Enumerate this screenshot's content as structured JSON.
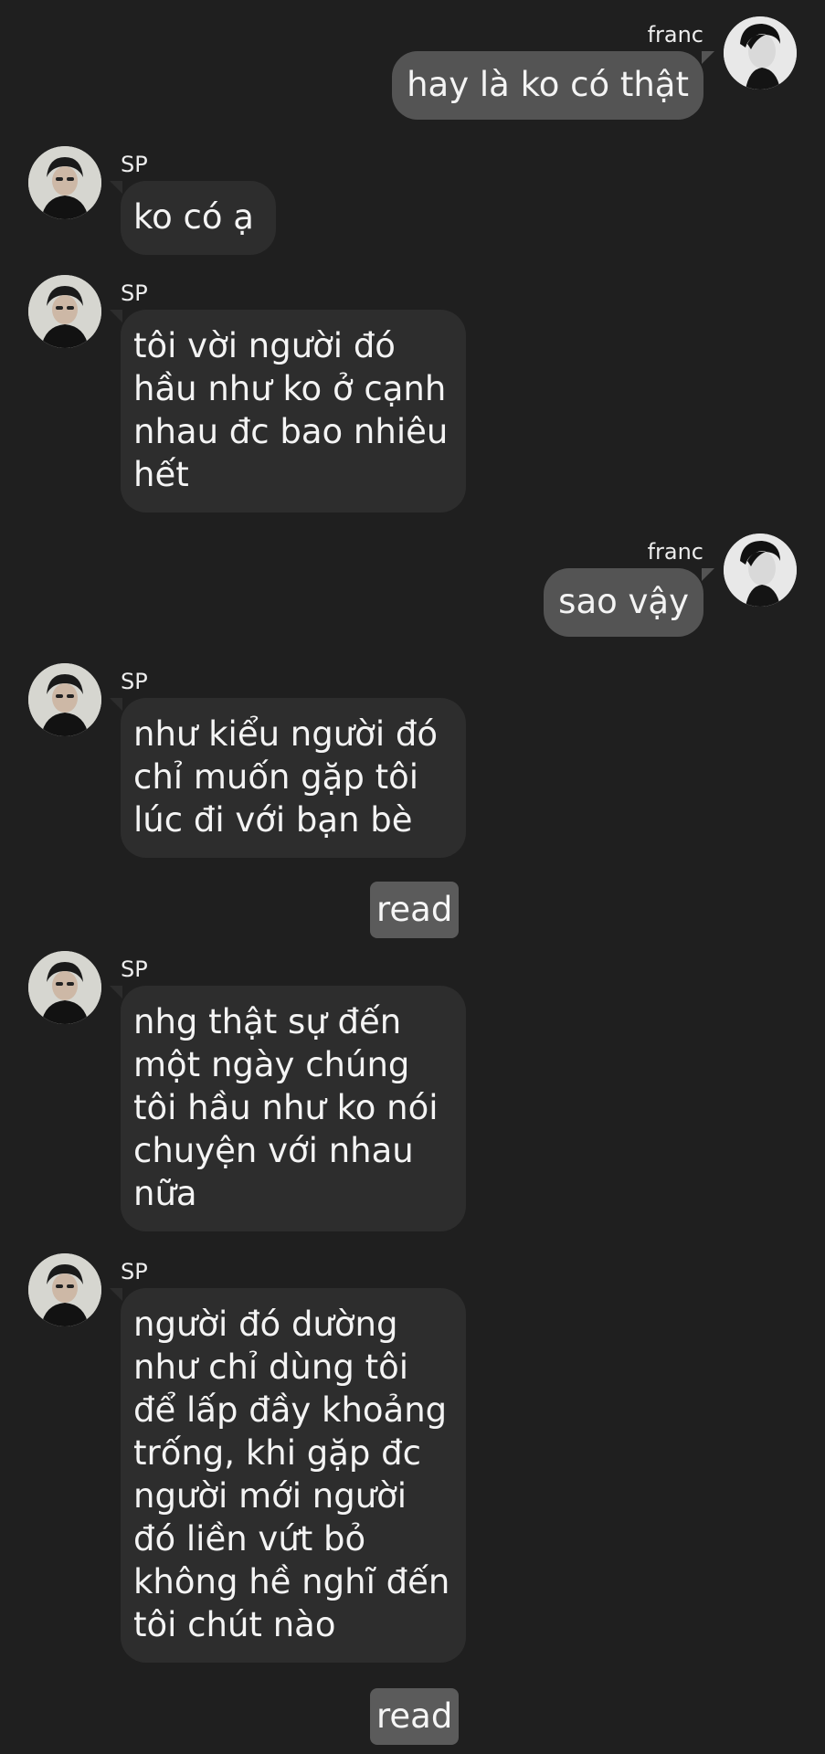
{
  "contacts": {
    "me": {
      "name": "franc",
      "avatar_icon": "profile-photo-icon"
    },
    "other": {
      "name": "SP",
      "avatar_icon": "profile-photo-icon"
    }
  },
  "messages": [
    {
      "from": "franc",
      "lines": [
        "hay là ko có thật"
      ]
    },
    {
      "from": "SP",
      "lines": [
        "ko có ạ"
      ]
    },
    {
      "from": "SP",
      "lines": [
        "tôi vời người đó",
        "hầu như ko ở cạnh",
        "nhau đc bao nhiêu",
        "hết"
      ]
    },
    {
      "from": "franc",
      "lines": [
        "sao vậy"
      ]
    },
    {
      "from": "SP",
      "lines": [
        "như kiểu người đó",
        "chỉ muốn gặp tôi",
        "lúc đi với bạn bè"
      ]
    },
    {
      "from": "SP",
      "lines": [
        "nhg thật sự đến",
        "một ngày chúng",
        "tôi hầu như ko nói",
        "chuyện với nhau",
        "nữa"
      ]
    },
    {
      "from": "SP",
      "lines": [
        "người đó dường",
        "như chỉ dùng tôi",
        "để lấp đầy khoảng",
        "trống, khi gặp đc",
        "người mới người",
        "đó liền vứt bỏ",
        "không hề nghĩ đến",
        "tôi chút nào"
      ]
    }
  ],
  "read_labels": [
    "read",
    "read"
  ],
  "colors": {
    "background": "#1f1f1f",
    "incoming_bubble": "#2d2d2d",
    "outgoing_bubble": "#545454",
    "read_badge": "#5b5b5b",
    "text": "#f4f4f4"
  }
}
